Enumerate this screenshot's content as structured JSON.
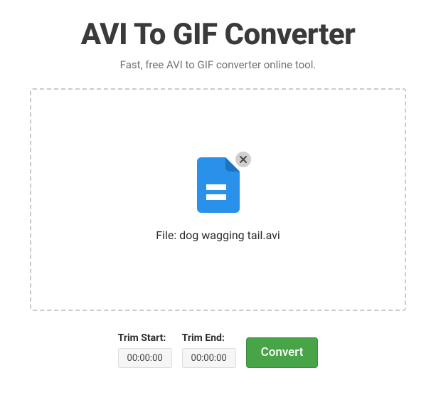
{
  "header": {
    "title": "AVI To GIF Converter",
    "subtitle": "Fast, free AVI to GIF converter online tool."
  },
  "dropzone": {
    "file_prefix": "File: ",
    "filename": "dog wagging tail.avi"
  },
  "controls": {
    "trim_start": {
      "label": "Trim Start:",
      "value": "00:00:00"
    },
    "trim_end": {
      "label": "Trim End:",
      "value": "00:00:00"
    },
    "convert_label": "Convert"
  },
  "colors": {
    "accent_blue": "#2a91eb",
    "convert_green": "#47a447"
  }
}
